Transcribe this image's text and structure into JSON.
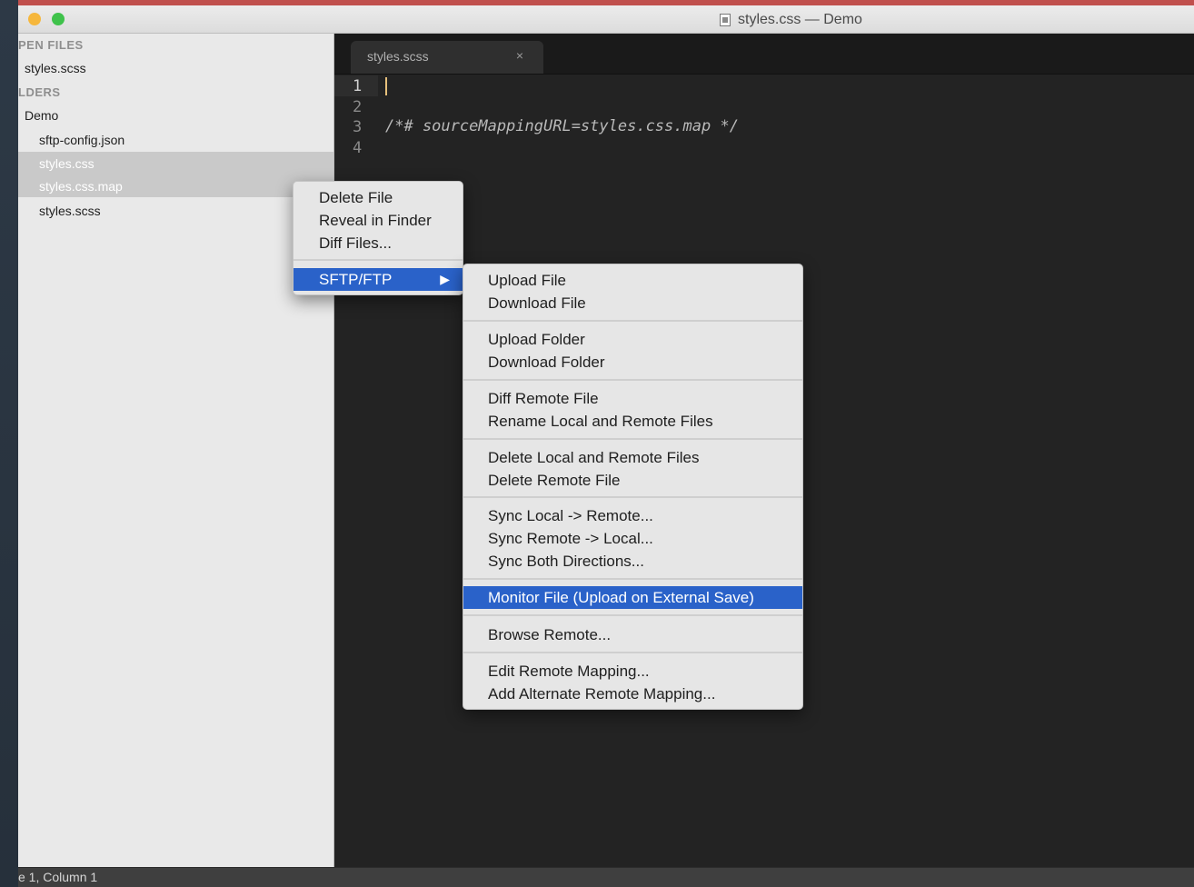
{
  "window": {
    "title": "styles.css — Demo"
  },
  "sidebar": {
    "open_files_header": "PEN FILES",
    "open_files": [
      "styles.scss"
    ],
    "folders_header": "LDERS",
    "folder_name": "Demo",
    "files": [
      {
        "name": "sftp-config.json"
      },
      {
        "name": "styles.css"
      },
      {
        "name": "styles.css.map"
      },
      {
        "name": "styles.scss"
      }
    ]
  },
  "editor": {
    "tab": {
      "label": "styles.scss",
      "close": "×"
    },
    "line_numbers": [
      "1",
      "2",
      "3",
      "4"
    ],
    "lines": [
      "",
      "",
      "/*# sourceMappingURL=styles.css.map */",
      ""
    ]
  },
  "context_menu": {
    "items": [
      "Delete File",
      "Reveal in Finder",
      "Diff Files...",
      "SFTP/FTP"
    ],
    "submenu_arrow": "▶"
  },
  "sftp_submenu": {
    "items": [
      "Upload File",
      "Download File",
      "Upload Folder",
      "Download Folder",
      "Diff Remote File",
      "Rename Local and Remote Files",
      "Delete Local and Remote Files",
      "Delete Remote File",
      "Sync Local -> Remote...",
      "Sync Remote -> Local...",
      "Sync Both Directions...",
      "Monitor File (Upload on External Save)",
      "Browse Remote...",
      "Edit Remote Mapping...",
      "Add Alternate Remote Mapping..."
    ]
  },
  "status": {
    "text": "e 1, Column 1"
  },
  "colors": {
    "accent": "#2a62c9",
    "selection": "#c9c9c9",
    "caret": "#e6c07b"
  }
}
